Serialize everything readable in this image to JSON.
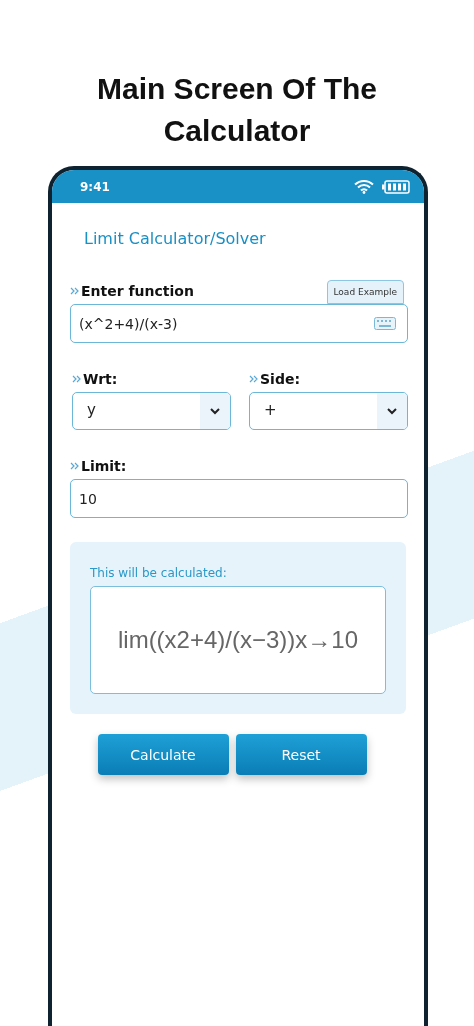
{
  "headline": "Main Screen Of The Calculator",
  "status_bar": {
    "time": "9:41"
  },
  "app": {
    "title": "Limit Calculator/Solver",
    "function_field": {
      "label": "Enter function",
      "load_example": "Load Example",
      "value": "(x^2+4)/(x-3)"
    },
    "selects": [
      {
        "label": "Wrt:",
        "value": "y"
      },
      {
        "label": "Side:",
        "value": "+"
      }
    ],
    "limit_field": {
      "label": "Limit:",
      "value": "10"
    },
    "preview": {
      "caption": "This will be calculated:",
      "expression": "lim((x2+4)/(x−3))x→10"
    },
    "buttons": [
      "Calculate",
      "Reset"
    ]
  }
}
